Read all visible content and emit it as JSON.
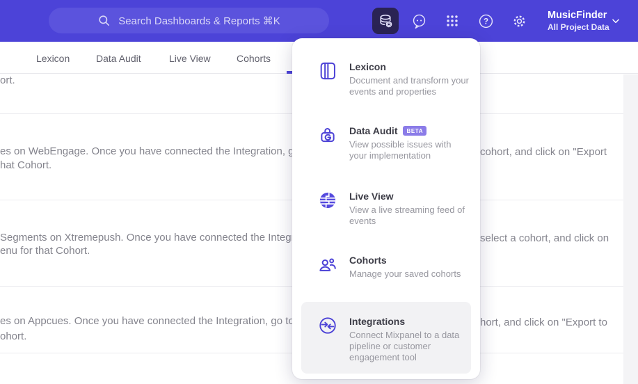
{
  "topbar": {
    "search": {
      "placeholder": "Search Dashboards & Reports ⌘K"
    },
    "project": {
      "name": "MusicFinder",
      "subtitle": "All Project Data"
    }
  },
  "tabs": {
    "items": [
      {
        "label": "Lexicon"
      },
      {
        "label": "Data Audit"
      },
      {
        "label": "Live View"
      },
      {
        "label": "Cohorts"
      }
    ]
  },
  "menu": {
    "items": [
      {
        "title": "Lexicon",
        "description": "Document and transform your events and properties",
        "icon": "lexicon-book-icon"
      },
      {
        "title": "Data Audit",
        "badge": "BETA",
        "description": "View possible issues with your implementation",
        "icon": "data-audit-lock-icon"
      },
      {
        "title": "Live View",
        "description": "View a live streaming feed of events",
        "icon": "live-view-globe-icon"
      },
      {
        "title": "Cohorts",
        "description": "Manage your saved cohorts",
        "icon": "cohorts-people-icon"
      },
      {
        "title": "Integrations",
        "description": "Connect Mixpanel to a data pipeline or customer engagement tool",
        "icon": "integrations-sync-icon"
      }
    ]
  },
  "content": {
    "rows": [
      {
        "f1": "ort."
      },
      {
        "f1": "es on WebEngage. Once you have connected the Integration, go to the",
        "f2": "cohort, and click on \"Export",
        "f3": "hat Cohort."
      },
      {
        "f1": "Segments on Xtremepush. Once you have connected the Integration,",
        "f2": "select a cohort, and click on",
        "f3": "enu for that Cohort."
      },
      {
        "f1": "es on Appcues. Once you have connected the Integration, go to the M",
        "f2": "hort, and click on \"Export to",
        "f3": "ohort."
      }
    ]
  },
  "colors": {
    "topbar": "#4c43d8",
    "accent": "#4c43d8",
    "icon_purple": "#4b41d6",
    "badge_bg": "#8b7ce8",
    "highlight_row": "#f2f2f4"
  }
}
